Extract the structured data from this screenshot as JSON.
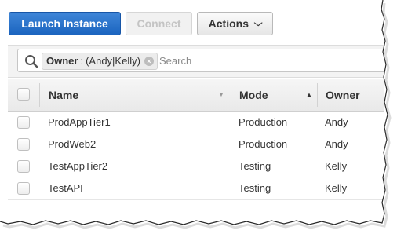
{
  "toolbar": {
    "launch_label": "Launch Instance",
    "connect_label": "Connect",
    "actions_label": "Actions",
    "actions_chevron": "chevron-down-icon"
  },
  "filter": {
    "token": {
      "key": "Owner",
      "separator": ":",
      "value": "(Andy|Kelly)"
    },
    "placeholder": "Search"
  },
  "table": {
    "columns": [
      {
        "label": "Name",
        "sort": "none"
      },
      {
        "label": "Mode",
        "sort": "ascending"
      },
      {
        "label": "Owner",
        "sort": "none"
      }
    ],
    "rows": [
      {
        "name": "ProdAppTier1",
        "mode": "Production",
        "owner": "Andy"
      },
      {
        "name": "ProdWeb2",
        "mode": "Production",
        "owner": "Andy"
      },
      {
        "name": "TestAppTier2",
        "mode": "Testing",
        "owner": "Kelly"
      },
      {
        "name": "TestAPI",
        "mode": "Testing",
        "owner": "Kelly"
      }
    ]
  },
  "colors": {
    "primary_button": "#1b64bf",
    "header_bg": "#eeeeee"
  }
}
